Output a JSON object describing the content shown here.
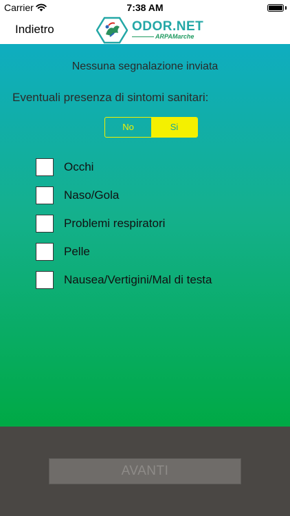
{
  "status_bar": {
    "carrier": "Carrier",
    "time": "7:38 AM",
    "battery_level": 1.0
  },
  "nav": {
    "back_label": "Indietro",
    "logo_text": "ODOR.NET",
    "logo_sub": "ARPAMarche"
  },
  "main": {
    "report_status": "Nessuna segnalazione inviata",
    "symptoms_question": "Eventuali presenza di sintomi sanitari:",
    "toggle": {
      "options": [
        "No",
        "Si"
      ],
      "selected": "Si"
    },
    "symptoms": [
      {
        "label": "Occhi",
        "checked": false
      },
      {
        "label": "Naso/Gola",
        "checked": false
      },
      {
        "label": "Problemi respiratori",
        "checked": false
      },
      {
        "label": "Pelle",
        "checked": false
      },
      {
        "label": "Nausea/Vertigini/Mal di testa",
        "checked": false
      }
    ]
  },
  "footer": {
    "next_label": "AVANTI"
  },
  "colors": {
    "gradient_top": "#0fadc0",
    "gradient_bottom": "#00a945",
    "toggle_accent": "#f4f000",
    "footer_bg": "#4a4744",
    "logo_teal": "#23a7a6"
  },
  "icons": {
    "wifi": "wifi-icon",
    "battery": "battery-icon",
    "logo": "odor-net-logo-icon"
  }
}
